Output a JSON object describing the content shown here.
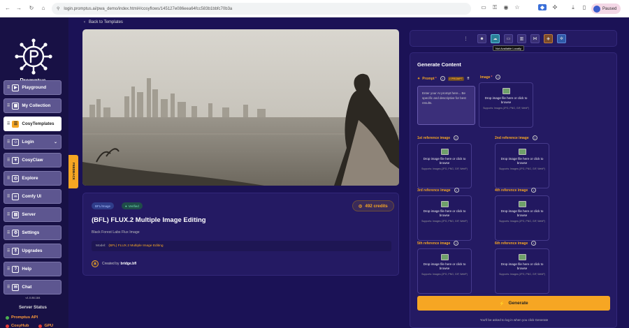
{
  "browser": {
    "url": "login.promptus.ai/pwa_demo/index.html#/cosyflows/145127e086eea64fcc583b1bbfc70b3a",
    "profile_status": "Paused"
  },
  "sidebar": {
    "brand": "Promptus",
    "items": [
      {
        "label": "Playground",
        "icon": "play-icon"
      },
      {
        "label": "My Collection",
        "icon": "grid-icon"
      },
      {
        "label": "CosyTemplates",
        "icon": "template-icon",
        "active": true
      },
      {
        "label": "Login",
        "icon": "user-icon"
      },
      {
        "label": "CosyClaw",
        "icon": "claw-icon"
      },
      {
        "label": "Explore",
        "icon": "compass-icon"
      },
      {
        "label": "Comfy UI",
        "icon": "link-icon"
      },
      {
        "label": "Server",
        "icon": "server-icon"
      },
      {
        "label": "Settings",
        "icon": "gear-icon"
      },
      {
        "label": "Upgrades",
        "icon": "rocket-icon"
      },
      {
        "label": "Help",
        "icon": "help-icon"
      },
      {
        "label": "Chat",
        "icon": "chat-icon"
      }
    ],
    "version": "v1.0.86.184",
    "server_status_title": "Server Status",
    "servers": [
      {
        "label": "Promptus API",
        "color": "#4caf50"
      },
      {
        "label": "CosyHub",
        "color": "#e53935"
      },
      {
        "label": "GPU",
        "color": "#e53935"
      }
    ]
  },
  "feedback_tab": "FEEDBACK",
  "nav": {
    "back_label": "Back to Templates"
  },
  "model": {
    "tags": [
      "BFL/Image",
      "Verified"
    ],
    "credits": "492 credits",
    "title": "(BFL) FLUX.2 Multiple Image Editing",
    "subtitle": "Black Forest Labs Flux Image",
    "model_label": "Model:",
    "model_value": "(BFL) FLUX.2 Multiple Image Editing",
    "created_by_label": "Created by",
    "creator": "bridge.bfl"
  },
  "toolbar": {
    "tooltip": "Not Available Locally"
  },
  "generate": {
    "title": "Generate Content",
    "prompt_label": "Prompt",
    "prompt_tag": "# PROMPT",
    "prompt_placeholder": "Enter your AI prompt here... Be specific and descriptive for best results.",
    "image_label": "Image",
    "drop_text": "Drop image file here or click to browse",
    "drop_support": "Supports: Images (JPG, PNG, GIF, WebP)",
    "refs": [
      "1st reference image",
      "2nd reference image",
      "3rd reference image",
      "4th reference image",
      "5th reference image",
      "6th reference image"
    ],
    "button": "Generate",
    "hint": "You'll be asked to log in when you click Generate"
  },
  "colors": {
    "accent": "#f6a623",
    "background": "#1b1256",
    "panel": "#241a63"
  }
}
